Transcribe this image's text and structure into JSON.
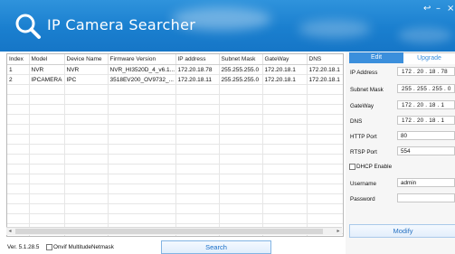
{
  "app": {
    "title": "IP Camera Searcher"
  },
  "window_controls": {
    "minimize": "↩",
    "restore": "–",
    "close": "×"
  },
  "table": {
    "columns": [
      "Index",
      "Model",
      "Device Name",
      "Firmware Version",
      "IP address",
      "Subnet Mask",
      "GateWay",
      "DNS"
    ],
    "rows": [
      [
        "1",
        "NVR",
        "NVR",
        "NVR_HI3520D_4_v6.1...",
        "172.20.18.78",
        "255.255.255.0",
        "172.20.18.1",
        "172.20.18.1"
      ],
      [
        "2",
        "IPCAMERA",
        "IPC",
        "3518EV200_OV9732_...",
        "172.20.18.11",
        "255.255.255.0",
        "172.20.18.1",
        "172.20.18.1"
      ]
    ]
  },
  "footer": {
    "version": "Ver. 5.1.28.5",
    "onvif_label": "Onvif MultitudeNetmask",
    "search_label": "Search"
  },
  "panel": {
    "tabs": [
      "Edit",
      "Upgrade"
    ],
    "ip_label": "IP Address",
    "ip_value": "172 . 20 . 18 . 78",
    "subnet_label": "Subnet Mask",
    "subnet_value": "255 . 255 . 255 . 0",
    "gateway_label": "GateWay",
    "gateway_value": "172 . 20 . 18 . 1",
    "dns_label": "DNS",
    "dns_value": "172 . 20 . 18 . 1",
    "http_label": "HTTP Port",
    "http_value": "80",
    "rtsp_label": "RTSP Port",
    "rtsp_value": "554",
    "dhcp_label": "DHCP Enable",
    "username_label": "Username",
    "username_value": "admin",
    "password_label": "Password",
    "password_value": "",
    "modify_label": "Modify"
  }
}
